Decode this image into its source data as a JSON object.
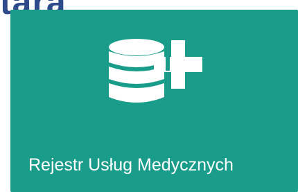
{
  "header": {
    "partial_title": "tara"
  },
  "tile": {
    "label": "Rejestr Usług Medycznych",
    "icon": "database-add-icon",
    "background_color": "#199d8a",
    "foreground_color": "#ffffff"
  }
}
